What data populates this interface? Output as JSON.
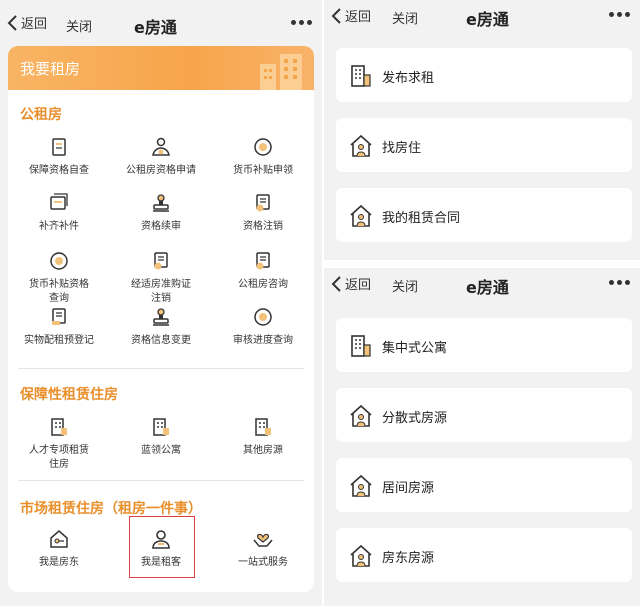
{
  "navbar": {
    "back_label": "返回",
    "close_label": "关闭",
    "title": "e房通"
  },
  "left": {
    "banner_title": "我要租房",
    "sections": [
      {
        "title": "公租房",
        "items": [
          {
            "label": "保障资格自查",
            "icon": "checklist-icon"
          },
          {
            "label": "公租房资格申请",
            "icon": "person-medal-icon"
          },
          {
            "label": "货币补贴申领",
            "icon": "coin-icon"
          },
          {
            "label": "补齐补件",
            "icon": "document-stack-icon"
          },
          {
            "label": "资格续审",
            "icon": "stamp-icon"
          },
          {
            "label": "资格注销",
            "icon": "document-coin-icon"
          },
          {
            "label": "货币补贴资格\n查询",
            "icon": "coin-icon"
          },
          {
            "label": "经适房准购证\n注销",
            "icon": "document-coin-icon"
          },
          {
            "label": "公租房咨询",
            "icon": "document-coin-icon"
          },
          {
            "label": "实物配租预登记",
            "icon": "document-pen-icon"
          },
          {
            "label": "资格信息变更",
            "icon": "stamp-icon"
          },
          {
            "label": "审核进度查询",
            "icon": "coin-icon"
          }
        ]
      },
      {
        "title": "保障性租赁住房",
        "items": [
          {
            "label": "人才专项租赁\n住房",
            "icon": "building-icon"
          },
          {
            "label": "蓝领公寓",
            "icon": "building-icon"
          },
          {
            "label": "其他房源",
            "icon": "building-icon"
          }
        ]
      },
      {
        "title": "市场租赁住房（租房一件事）",
        "items": [
          {
            "label": "我是房东",
            "icon": "house-key-icon"
          },
          {
            "label": "我是租客",
            "icon": "person-icon"
          },
          {
            "label": "一站式服务",
            "icon": "heart-hands-icon"
          }
        ]
      }
    ]
  },
  "right_top": {
    "items": [
      {
        "label": "发布求租",
        "icon": "apartment-building-icon"
      },
      {
        "label": "找房住",
        "icon": "house-person-icon"
      },
      {
        "label": "我的租赁合同",
        "icon": "house-person-icon"
      }
    ]
  },
  "right_bottom": {
    "items": [
      {
        "label": "集中式公寓",
        "icon": "apartment-building-icon"
      },
      {
        "label": "分散式房源",
        "icon": "house-person-icon"
      },
      {
        "label": "居间房源",
        "icon": "house-person-icon"
      },
      {
        "label": "房东房源",
        "icon": "house-person-icon"
      }
    ]
  },
  "colors": {
    "accent": "#e98f2b",
    "banner": "#f7a54a",
    "highlight": "#e04040",
    "icon_dark": "#333333",
    "icon_light": "#f2c27a"
  }
}
